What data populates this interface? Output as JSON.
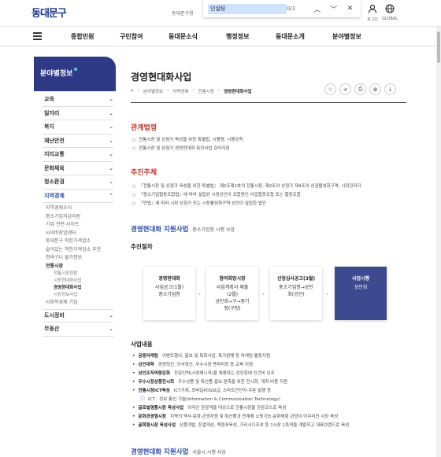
{
  "header": {
    "logo": "동대문구",
    "gnb_text": "동대문구청",
    "find": {
      "value": "인설팅",
      "count": "0/1"
    },
    "login_label": "로그인",
    "global_label": "GLOBAL"
  },
  "gnb": {
    "items": [
      "종합민원",
      "구민참여",
      "동대문소식",
      "행정정보",
      "동대문소개",
      "분야별정보"
    ]
  },
  "sidebar": {
    "title": "분야별정보",
    "items": [
      "교육",
      "일자리",
      "복지",
      "재난안전",
      "지리교통",
      "문화체육",
      "청소환경",
      "지역경제"
    ],
    "sub_items": [
      "지역경제소식",
      "중소기업자금지원",
      "기업 관련 사이트",
      "사이버창업센터",
      "동대문구 착한가격업소",
      "술어있는 착한가격업소 추천",
      "청바구니 물가정보",
      "전통시장"
    ],
    "subsub_items": [
      "전통시장현황",
      "시장현대화사업",
      "경영현대화사업",
      "시장정보사업"
    ],
    "after_items": [
      "사회적경제 기업"
    ],
    "bottom_items": [
      "도시정비",
      "무동산"
    ]
  },
  "main": {
    "title": "경영현대화사업",
    "breadcrumb": [
      "분야별정보",
      "지역경제",
      "전통시장",
      "경영현대화사업"
    ],
    "section_law": {
      "heading": "관계법령",
      "items": [
        "전통시장 및 상점가 육성을 위한 특별법, 시행령, 시행규칙",
        "전통시장 및 상점가 경영현대화 촉진사업 관리지침"
      ]
    },
    "section_actor": {
      "heading": "추진주체",
      "items": [
        "『전통시장 및 상점가 육성을 위한 특별법』 제2조제1호의 전통시장, 제2조의 상점가 제4조의 상권활성화구역, 시장관리자",
        "『중소기업협동조합법』에 따라 설립된 시장상인이 조합원인 사업협동조합 또는 협동조합",
        "『민법』에 따라 시장·상점가 또는 시장활성화구역 상인이 설립한 법인"
      ]
    },
    "section_support": {
      "heading": "경영현대화 지원사업",
      "sub": "중소기업청 시행 사업",
      "process_heading": "추진절차",
      "process": [
        {
          "title": "경영현대화",
          "lines": [
            "사업공고(1월)",
            "중소기업청"
          ]
        },
        {
          "title": "참여희망시장",
          "lines": [
            "사업계획서 제출",
            "(2월)",
            "상인회→구→중기",
            "청(구청)"
          ]
        },
        {
          "title": "선정심사공고(3월)",
          "lines": [
            "중소기업청→상인",
            "회(공단)"
          ]
        },
        {
          "title": "사업시행",
          "lines": [
            "상인회"
          ]
        }
      ],
      "content_heading": "사업내용",
      "content": [
        {
          "k": "공동마케팅",
          "v": "이벤트행사, 홍보 및 특화사업, 특가판매 등 마케팅 활동지원"
        },
        {
          "k": "상인대학",
          "v": "경영혁신, 의식혁신, 우수시장 벤치마킹 등 교육 지원"
        },
        {
          "k": "상인조직역량강화",
          "v": "전문인력(시장매니저)을 채용하는 상인회에 인건비 보조"
        },
        {
          "k": "우수시장상품전시회",
          "v": "우수상품 및 특산품 홍보·판촉을 위한 전시회, 개최 비용 지원"
        },
        {
          "k": "전통시장ICT육성",
          "v": "ICT기계, 모바일POS보급, 스마트전단지·쿠폰 발행 등"
        },
        {
          "k": "",
          "v": "ICT : 정보 통신 기술(Information & Communication Technology)",
          "note": true
        },
        {
          "k": "글로벌명품시장 육성사업",
          "v": "외국인 관광객을 대상으로 전통시장을 관광코스로 육성"
        },
        {
          "k": "문화관광형시장",
          "v": "지역의 역사·문화·관광자원 및 특산품과 연계해 쇼핑기능·문화체험 관광이 어우러진 시장 육성"
        },
        {
          "k": "골목형시장 육성사업",
          "v": "상품개발, 진열개선, 맥점포육성, 거리시디조성 등 1시장 1특색을 개발하고 대표브랜드로 육성"
        }
      ],
      "bottom_heading": "경영현대화 지원사업",
      "bottom_sub": "서울시 시행 사업"
    }
  }
}
